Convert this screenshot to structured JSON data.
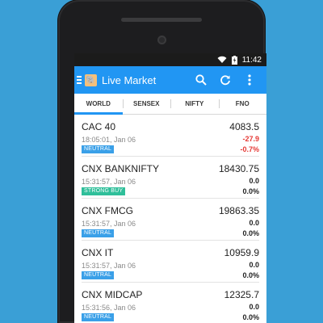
{
  "colors": {
    "background": "#3a9fd6",
    "app_bar": "#2196f3",
    "neutral_badge": "#3aa0e8",
    "strong_buy_badge": "#2fbf9a",
    "negative": "#e53935",
    "zero": "#222222"
  },
  "status_bar": {
    "time": "11:42",
    "icons": [
      "wifi-icon",
      "battery-charging-icon"
    ]
  },
  "app_bar": {
    "title": "Live Market",
    "actions": [
      "search-icon",
      "refresh-icon",
      "more-vert-icon"
    ]
  },
  "tabs": [
    {
      "label": "WORLD",
      "active": true
    },
    {
      "label": "SENSEX",
      "active": false
    },
    {
      "label": "NIFTY",
      "active": false
    },
    {
      "label": "FNO",
      "active": false
    }
  ],
  "items": [
    {
      "name": "CAC 40",
      "price": "4083.5",
      "time": "18:05:01, Jan 06",
      "change": "-27.9",
      "pct": "-0.7%",
      "badge": "NEUTRAL",
      "badge_color": "#3aa0e8",
      "change_color": "#e53935"
    },
    {
      "name": "CNX BANKNIFTY",
      "price": "18430.75",
      "time": "15:31:57, Jan 06",
      "change": "0.0",
      "pct": "0.0%",
      "badge": "STRONG BUY",
      "badge_color": "#2fbf9a",
      "change_color": "#222222"
    },
    {
      "name": "CNX FMCG",
      "price": "19863.35",
      "time": "15:31:57, Jan 06",
      "change": "0.0",
      "pct": "0.0%",
      "badge": "NEUTRAL",
      "badge_color": "#3aa0e8",
      "change_color": "#222222"
    },
    {
      "name": "CNX IT",
      "price": "10959.9",
      "time": "15:31:57, Jan 06",
      "change": "0.0",
      "pct": "0.0%",
      "badge": "NEUTRAL",
      "badge_color": "#3aa0e8",
      "change_color": "#222222"
    },
    {
      "name": "CNX MIDCAP",
      "price": "12325.7",
      "time": "15:31:56, Jan 06",
      "change": "0.0",
      "pct": "0.0%",
      "badge": "NEUTRAL",
      "badge_color": "#3aa0e8",
      "change_color": "#222222"
    }
  ]
}
